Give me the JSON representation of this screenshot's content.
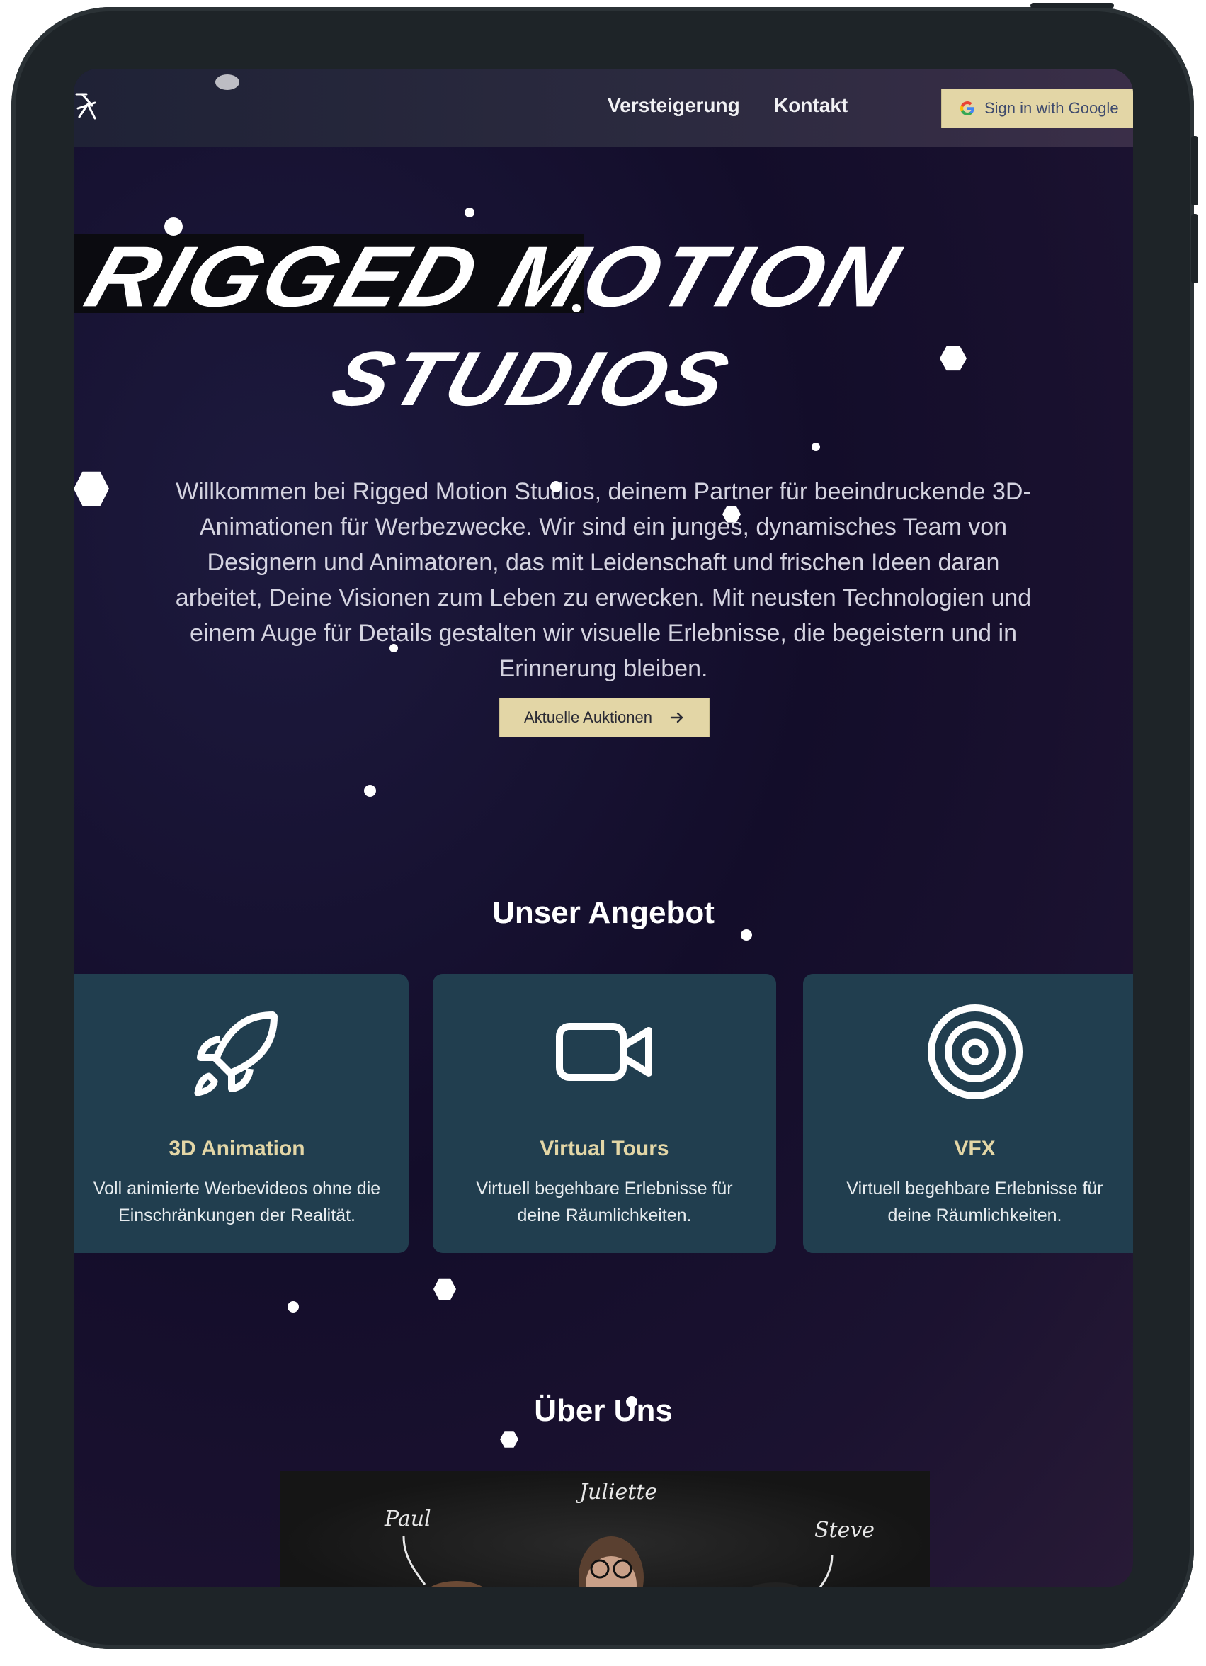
{
  "nav": {
    "logo_icon": "stick-figure-icon",
    "links": [
      "Versteigerung",
      "Kontakt"
    ],
    "signin_label": "Sign in with Google",
    "signin_icon": "google-g-icon"
  },
  "hero": {
    "title_line1": "RIGGED MOTION",
    "title_line2": "STUDIOS",
    "intro": "Willkommen bei Rigged Motion Studios, deinem Partner für beeindruckende 3D-Animationen für Werbezwecke. Wir sind ein junges, dynamisches Team von Designern und Animatoren, das mit Leidenschaft und frischen Ideen daran arbeitet, Deine Visionen zum Leben zu erwecken. Mit neusten Technologien und einem Auge für Details gestalten wir visuelle Erlebnisse, die begeistern und in Erinnerung bleiben.",
    "cta_label": "Aktuelle Auktionen",
    "cta_icon": "arrow-right-icon"
  },
  "offer": {
    "heading": "Unser Angebot",
    "cards": [
      {
        "icon": "rocket-icon",
        "title": "3D Animation",
        "text": "Voll animierte Werbevideos ohne die Einschränkungen der Realität."
      },
      {
        "icon": "video-camera-icon",
        "title": "Virtual Tours",
        "text": "Virtuell begehbare Erlebnisse für deine Räumlichkeiten."
      },
      {
        "icon": "target-icon",
        "title": "VFX",
        "text": "Virtuell begehbare Erlebnisse für deine Räumlichkeiten."
      }
    ]
  },
  "about": {
    "heading": "Über Uns",
    "photo_names": [
      "Paul",
      "Juliette",
      "Steve"
    ]
  },
  "colors": {
    "accent": "#e3d6a6",
    "card_bg": "#213e4f",
    "card_title": "#e3d6a6",
    "background": "#130d2a"
  }
}
